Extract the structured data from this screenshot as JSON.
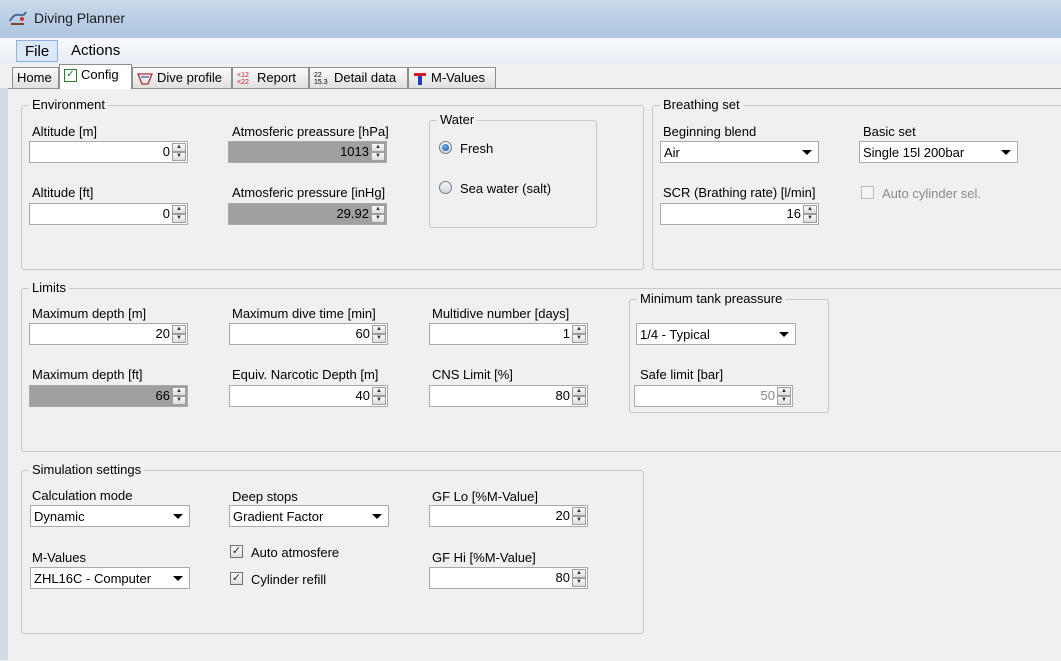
{
  "window": {
    "title": "Diving Planner"
  },
  "menu": {
    "file": "File",
    "actions": "Actions"
  },
  "tabs": {
    "home": "Home",
    "config": "Config",
    "dive_profile": "Dive profile",
    "report": "Report",
    "detail_data": "Detail data",
    "m_values": "M-Values"
  },
  "environment": {
    "title": "Environment",
    "altitude_m_label": "Altitude [m]",
    "altitude_m_value": "0",
    "altitude_ft_label": "Altitude [ft]",
    "altitude_ft_value": "0",
    "atm_hpa_label": "Atmosferic preassure [hPa]",
    "atm_hpa_value": "1013",
    "atm_inhg_label": "Atmosferic pressure [inHg]",
    "atm_inhg_value": "29.92",
    "water": {
      "title": "Water",
      "fresh": "Fresh",
      "sea": "Sea water (salt)",
      "selected": "fresh"
    }
  },
  "breathing": {
    "title": "Breathing set",
    "blend_label": "Beginning blend",
    "blend_value": "Air",
    "basic_label": "Basic set",
    "basic_value": "Single 15l 200bar",
    "scr_label": "SCR (Brathing rate) [l/min]",
    "scr_value": "16",
    "auto_cyl_label": "Auto cylinder sel."
  },
  "limits": {
    "title": "Limits",
    "max_depth_m_label": "Maximum depth [m]",
    "max_depth_m_value": "20",
    "max_depth_ft_label": "Maximum depth [ft]",
    "max_depth_ft_value": "66",
    "max_time_label": "Maximum dive time [min]",
    "max_time_value": "60",
    "end_label": "Equiv. Narcotic Depth [m]",
    "end_value": "40",
    "multidive_label": "Multidive number [days]",
    "multidive_value": "1",
    "cns_label": "CNS Limit [%]",
    "cns_value": "80",
    "min_tank": {
      "title": "Minimum tank preassure",
      "select_value": "1/4 - Typical",
      "safe_label": "Safe limit [bar]",
      "safe_value": "50"
    }
  },
  "simulation": {
    "title": "Simulation settings",
    "calc_label": "Calculation mode",
    "calc_value": "Dynamic",
    "deep_label": "Deep stops",
    "deep_value": "Gradient Factor",
    "gflo_label": "GF Lo [%M-Value]",
    "gflo_value": "20",
    "mvalues_label": "M-Values",
    "mvalues_value": "ZHL16C - Computer",
    "auto_atm_label": "Auto atmosfere",
    "cyl_refill_label": "Cylinder refill",
    "gfhi_label": "GF Hi [%M-Value]",
    "gfhi_value": "80"
  }
}
